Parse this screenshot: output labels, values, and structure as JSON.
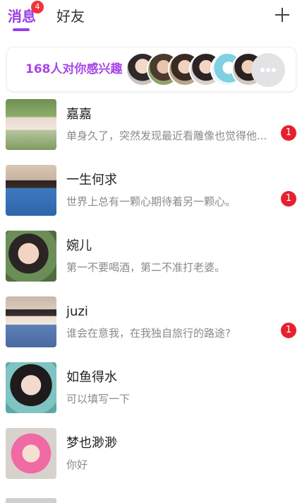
{
  "header": {
    "tabs": [
      {
        "label": "消息",
        "badge": "4",
        "active": true
      },
      {
        "label": "好友",
        "active": false
      }
    ],
    "add_icon": "plus-icon",
    "accent_color": "#9b3de8"
  },
  "interest_banner": {
    "text": "168人对你感兴趣",
    "more_icon": "more-dots-icon",
    "text_color": "#a845e8"
  },
  "chats": [
    {
      "name": "嘉嘉",
      "message": "单身久了，突然发现最近看雕像也觉得他...",
      "unread": "1",
      "avatar_icon": "user-photo"
    },
    {
      "name": "一生何求",
      "message": "世界上总有一颗心期待着另一颗心。",
      "unread": "1",
      "avatar_icon": "user-photo"
    },
    {
      "name": "婉儿",
      "message": "第一不要喝酒，第二不准打老婆。",
      "unread": "",
      "avatar_icon": "user-photo"
    },
    {
      "name": "juzi",
      "message": "谁会在意我，在我独自旅行的路途?",
      "unread": "1",
      "avatar_icon": "user-photo"
    },
    {
      "name": "如鱼得水",
      "message": "可以填写一下",
      "unread": "",
      "avatar_icon": "user-photo"
    },
    {
      "name": "梦也渺渺",
      "message": "你好",
      "unread": "",
      "avatar_icon": "user-photo"
    }
  ],
  "colors": {
    "unread_badge": "#e5212f",
    "muted_text": "#8a8a8a"
  }
}
